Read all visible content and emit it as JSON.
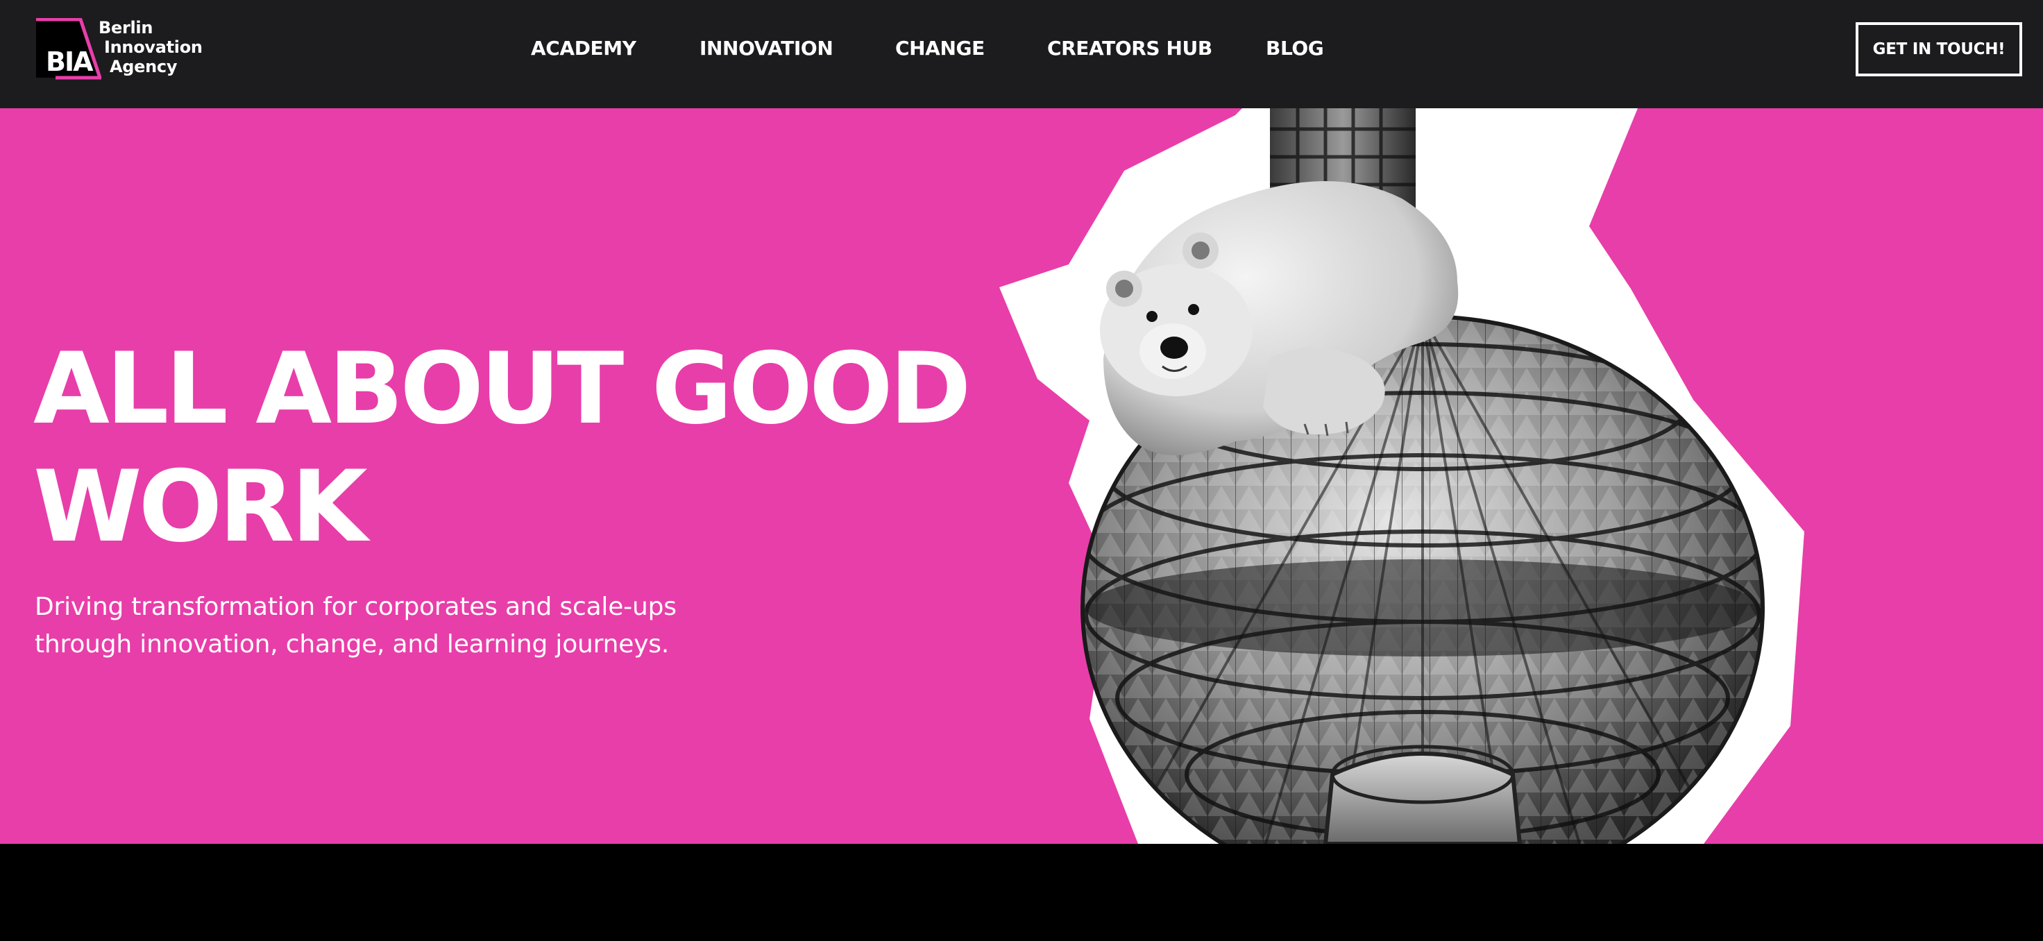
{
  "brand": {
    "logo_mark": "BIA",
    "name_line1": "Berlin",
    "name_line2": "Innovation",
    "name_line3": "Agency",
    "accent_color": "#e83ea9"
  },
  "nav": {
    "items": [
      {
        "label": "ACADEMY"
      },
      {
        "label": "INNOVATION"
      },
      {
        "label": "CHANGE"
      },
      {
        "label": "CREATORS HUB"
      },
      {
        "label": "BLOG"
      }
    ],
    "cta_label": "GET IN TOUCH!"
  },
  "hero": {
    "title_line1": "ALL ABOUT GOOD",
    "title_line2": "WORK",
    "subtitle_line1": "Driving transformation for corporates and scale-ups",
    "subtitle_line2": "through innovation, change, and learning journeys.",
    "image_subject": "polar-bear-on-berlin-tv-tower",
    "background_color": "#e83ea9"
  },
  "colors": {
    "header_bg": "#1c1c1e",
    "text": "#ffffff",
    "footer_band": "#000000"
  }
}
